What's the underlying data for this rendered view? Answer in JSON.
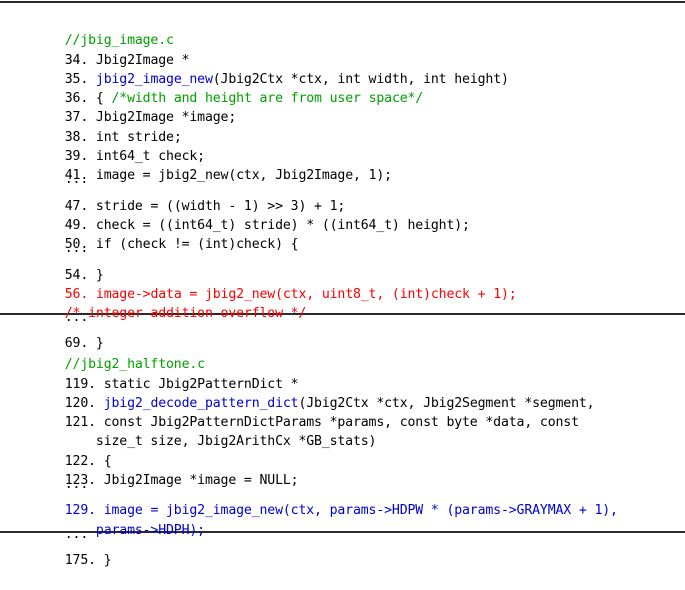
{
  "figure": {
    "type": "source-code-listing",
    "background": "#ffffff",
    "rule_color": "#2b2b2b",
    "colors": {
      "comment_green": "#00a000",
      "function_blue": "#0000d2",
      "vulnerable_red": "#fe0000",
      "code_black": "#000000"
    }
  },
  "panels": [
    {
      "id": "panel-top",
      "file_comment": "//jbig_image.c",
      "lines": [
        {
          "number": "34.",
          "text": "Jbig2Image *",
          "color": "black",
          "kind": "code"
        },
        {
          "number": "35.",
          "text": "jbig2_image_new(Jbig2Ctx *ctx, int width, int height)",
          "color": "mixed-blue-call",
          "kind": "code",
          "call_name": "jbig2_image_new",
          "call_args": "(Jbig2Ctx *ctx, int width, int height)"
        },
        {
          "number": "36.",
          "text": "{ /*width and height are from user space*/",
          "color": "mixed-comment",
          "kind": "code",
          "code_part": "{ ",
          "comment_part": "/*width and height are from user space*/"
        },
        {
          "number": "37.",
          "text": "Jbig2Image *image;",
          "color": "black",
          "kind": "code"
        },
        {
          "number": "38.",
          "text": "int stride;",
          "color": "black",
          "kind": "code"
        },
        {
          "number": "39.",
          "text": "int64_t check;",
          "color": "black",
          "kind": "code"
        },
        {
          "number": "41.",
          "text": "image = jbig2_new(ctx, Jbig2Image, 1);",
          "color": "black",
          "kind": "code"
        },
        {
          "number": "",
          "text": "...",
          "color": "black",
          "kind": "elision"
        },
        {
          "number": "47.",
          "text": "stride = ((width - 1) >> 3) + 1;",
          "color": "black",
          "kind": "code"
        },
        {
          "number": "49.",
          "text": "check = ((int64_t) stride) * ((int64_t) height);",
          "color": "black",
          "kind": "code"
        },
        {
          "number": "50.",
          "text": "if (check != (int)check) {",
          "color": "black",
          "kind": "code"
        },
        {
          "number": "",
          "text": "...",
          "color": "black",
          "kind": "elision"
        },
        {
          "number": "54.",
          "text": "}",
          "color": "black",
          "kind": "code"
        },
        {
          "number": "56.",
          "text": "image->data = jbig2_new(ctx, uint8_t, (int)check + 1);",
          "color": "red",
          "kind": "code"
        },
        {
          "number": "",
          "text": "/* integer addition overflow */",
          "color": "red",
          "kind": "code-nonum"
        },
        {
          "number": "",
          "text": "...",
          "color": "black",
          "kind": "elision"
        },
        {
          "number": "69.",
          "text": "}",
          "color": "black",
          "kind": "code"
        }
      ]
    },
    {
      "id": "panel-bottom",
      "file_comment": "//jbig2_halftone.c",
      "lines": [
        {
          "number": "119.",
          "text": "static Jbig2PatternDict *",
          "color": "black",
          "kind": "code"
        },
        {
          "number": "120.",
          "text": "jbig2_decode_pattern_dict(Jbig2Ctx *ctx, Jbig2Segment *segment,",
          "color": "mixed-blue-call",
          "kind": "code",
          "call_name": "jbig2_decode_pattern_dict",
          "call_args": "(Jbig2Ctx *ctx, Jbig2Segment *segment,"
        },
        {
          "number": "121.",
          "text": "const Jbig2PatternDictParams *params, const byte *data, const",
          "color": "black",
          "kind": "code"
        },
        {
          "number": "",
          "text": "size_t size, Jbig2ArithCx *GB_stats)",
          "color": "black",
          "kind": "continuation"
        },
        {
          "number": "122.",
          "text": "{",
          "color": "black",
          "kind": "code"
        },
        {
          "number": "123.",
          "text": "Jbig2Image *image = NULL;",
          "color": "black",
          "kind": "code"
        },
        {
          "number": "",
          "text": "...",
          "color": "black",
          "kind": "elision"
        },
        {
          "number": "129.",
          "text": "image = jbig2_image_new(ctx, params->HDPW * (params->GRAYMAX + 1),",
          "color": "blue",
          "kind": "code"
        },
        {
          "number": "",
          "text": "params->HDPH);",
          "color": "blue",
          "kind": "continuation"
        },
        {
          "number": "",
          "text": "...",
          "color": "black",
          "kind": "elision"
        },
        {
          "number": "175.",
          "text": "}",
          "color": "black",
          "kind": "code"
        }
      ]
    }
  ]
}
